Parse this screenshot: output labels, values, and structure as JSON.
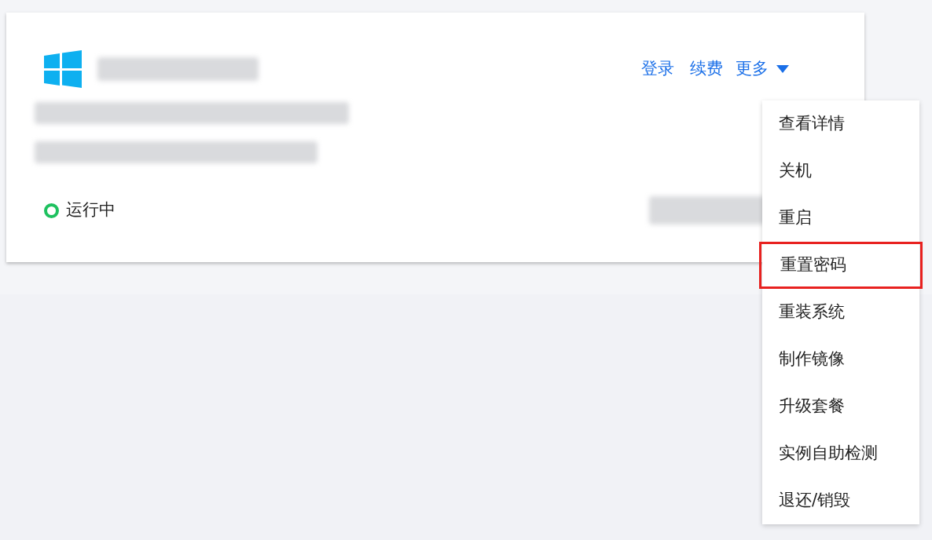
{
  "card": {
    "actions": [
      {
        "label": "登录",
        "kind": "link"
      },
      {
        "label": "续费",
        "kind": "link"
      },
      {
        "label": "更多",
        "kind": "dropdown",
        "expanded": true
      }
    ],
    "status": {
      "label": "运行中",
      "color": "#1ec15f"
    }
  },
  "menu": {
    "items": [
      {
        "label": "查看详情",
        "highlighted": false
      },
      {
        "label": "关机",
        "highlighted": false
      },
      {
        "label": "重启",
        "highlighted": false
      },
      {
        "label": "重置密码",
        "highlighted": true
      },
      {
        "label": "重装系统",
        "highlighted": false
      },
      {
        "label": "制作镜像",
        "highlighted": false
      },
      {
        "label": "升级套餐",
        "highlighted": false
      },
      {
        "label": "实例自助检测",
        "highlighted": false
      },
      {
        "label": "退还/销毁",
        "highlighted": false
      }
    ]
  }
}
